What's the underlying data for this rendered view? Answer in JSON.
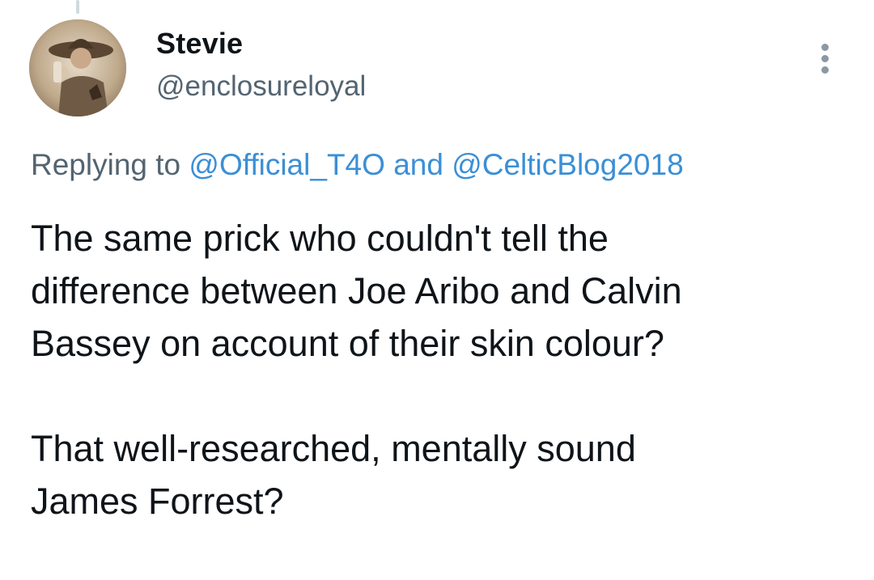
{
  "tweet": {
    "author": {
      "display_name": "Stevie",
      "handle": "@enclosureloyal"
    },
    "reply": {
      "prefix": "Replying to",
      "mention_1": "@Official_T4O",
      "joiner": "and",
      "mention_2": "@CelticBlog2018"
    },
    "text": "The same prick who couldn't tell the\ndifference between Joe Aribo and Calvin\nBassey on account of their skin colour?\n\nThat well-researched, mentally sound\nJames Forrest?"
  },
  "colors": {
    "text": "#0f1419",
    "secondary": "#536471",
    "mention": "#3b8fd6",
    "thread_line": "#cfd9de"
  },
  "icons": {
    "more": "more-vertical-icon"
  }
}
